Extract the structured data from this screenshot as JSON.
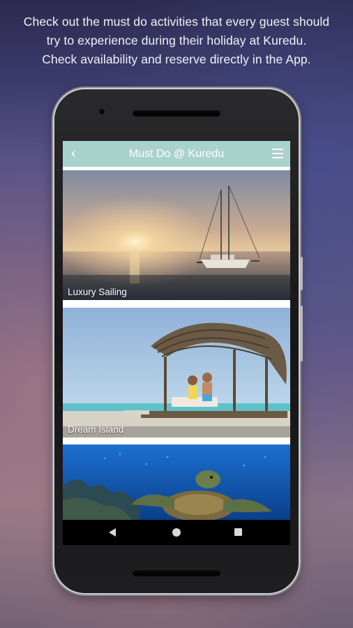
{
  "headline": {
    "line1": "Check out the must do activities that every guest should",
    "line2": "try to experience during their holiday at Kuredu.",
    "line3": "Check availability and reserve directly in the App."
  },
  "app": {
    "title": "Must Do @ Kuredu",
    "back_glyph": "‹",
    "back_icon": "chevron-left-icon",
    "menu_icon": "hamburger-menu-icon",
    "appbar_color": "#a9d2cd"
  },
  "activities": [
    {
      "label": "Luxury Sailing",
      "image": "sunset-sailing-yacht"
    },
    {
      "label": "Dream Island",
      "image": "couple-on-sandbank-hut"
    },
    {
      "label": "",
      "image": "sea-turtle-underwater"
    }
  ],
  "navbar": {
    "icons": [
      "nav-back-icon",
      "nav-home-icon",
      "nav-recent-apps-icon"
    ]
  }
}
